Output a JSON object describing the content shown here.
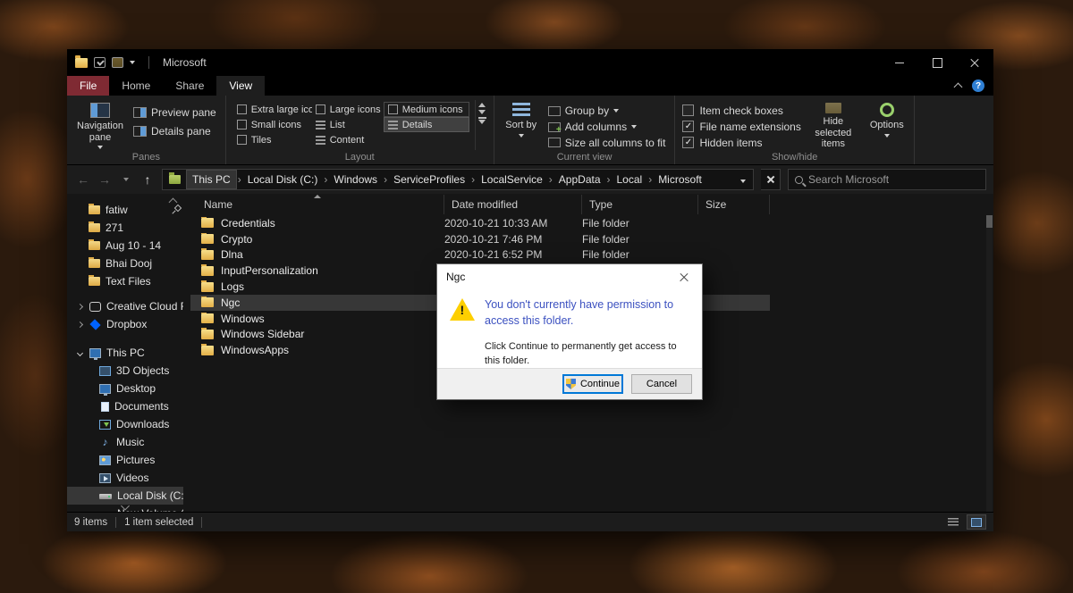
{
  "colors": {
    "accent_blue": "#0078d7",
    "file_tab_red": "#7f2a33",
    "selection_gray": "#373737",
    "instruction_blue": "#3c51c0",
    "warning_yellow": "#fdcf00",
    "folder_yellow": "#e3af47"
  },
  "titlebar": {
    "title": "Microsoft"
  },
  "ribbon_tabs": {
    "file": "File",
    "home": "Home",
    "share": "Share",
    "view": "View"
  },
  "ribbon": {
    "panes": {
      "group_label": "Panes",
      "navigation_pane": "Navigation pane",
      "preview_pane": "Preview pane",
      "details_pane": "Details pane"
    },
    "layout": {
      "group_label": "Layout",
      "items": [
        "Extra large icons",
        "Large icons",
        "Medium icons",
        "Small icons",
        "List",
        "Details",
        "Tiles",
        "Content"
      ],
      "selected": "Details"
    },
    "current_view": {
      "group_label": "Current view",
      "sort_by": "Sort by",
      "group_by": "Group by",
      "add_columns": "Add columns",
      "size_all_columns": "Size all columns to fit"
    },
    "show_hide": {
      "group_label": "Show/hide",
      "checkboxes": [
        {
          "label": "Item check boxes",
          "mark": ""
        },
        {
          "label": "File name extensions",
          "mark": "✓"
        },
        {
          "label": "Hidden items",
          "mark": "✓"
        }
      ],
      "hide_selected": "Hide selected items",
      "options": "Options"
    }
  },
  "addressbar": {
    "separator": "›",
    "crumbs": [
      "This PC",
      "Local Disk (C:)",
      "Windows",
      "ServiceProfiles",
      "LocalService",
      "AppData",
      "Local",
      "Microsoft"
    ],
    "search_placeholder": "Search Microsoft"
  },
  "sidebar": {
    "quick_access": [
      {
        "label": "fatiw"
      },
      {
        "label": "271"
      },
      {
        "label": "Aug 10 - 14"
      },
      {
        "label": "Bhai Dooj"
      },
      {
        "label": "Text Files"
      }
    ],
    "cloud": [
      {
        "label": "Creative Cloud Fil"
      },
      {
        "label": "Dropbox"
      }
    ],
    "this_pc": {
      "label": "This PC"
    },
    "this_pc_children": [
      {
        "label": "3D Objects"
      },
      {
        "label": "Desktop"
      },
      {
        "label": "Documents"
      },
      {
        "label": "Downloads"
      },
      {
        "label": "Music"
      },
      {
        "label": "Pictures"
      },
      {
        "label": "Videos"
      },
      {
        "label": "Local Disk (C:)"
      },
      {
        "label": "New Volume (D"
      }
    ]
  },
  "filelist": {
    "columns": {
      "name": "Name",
      "date": "Date modified",
      "type": "Type",
      "size": "Size"
    },
    "rows": [
      {
        "name": "Credentials",
        "date": "2020-10-21 10:33 AM",
        "type": "File folder",
        "size": ""
      },
      {
        "name": "Crypto",
        "date": "2020-10-21 7:46 PM",
        "type": "File folder",
        "size": ""
      },
      {
        "name": "Dlna",
        "date": "2020-10-21 6:52 PM",
        "type": "File folder",
        "size": ""
      },
      {
        "name": "InputPersonalization",
        "date": "",
        "type": "",
        "size": ""
      },
      {
        "name": "Logs",
        "date": "",
        "type": "",
        "size": ""
      },
      {
        "name": "Ngc",
        "date": "",
        "type": "",
        "size": ""
      },
      {
        "name": "Windows",
        "date": "",
        "type": "",
        "size": ""
      },
      {
        "name": "Windows Sidebar",
        "date": "",
        "type": "",
        "size": ""
      },
      {
        "name": "WindowsApps",
        "date": "",
        "type": "",
        "size": ""
      }
    ],
    "selected_row": "Ngc"
  },
  "statusbar": {
    "items_count": "9 items",
    "selection": "1 item selected",
    "separator": "|"
  },
  "dialog": {
    "title": "Ngc",
    "main_instruction": "You don't currently have permission to access this folder.",
    "body": "Click Continue to permanently get access to this folder.",
    "buttons": {
      "continue": "Continue",
      "cancel": "Cancel"
    }
  }
}
